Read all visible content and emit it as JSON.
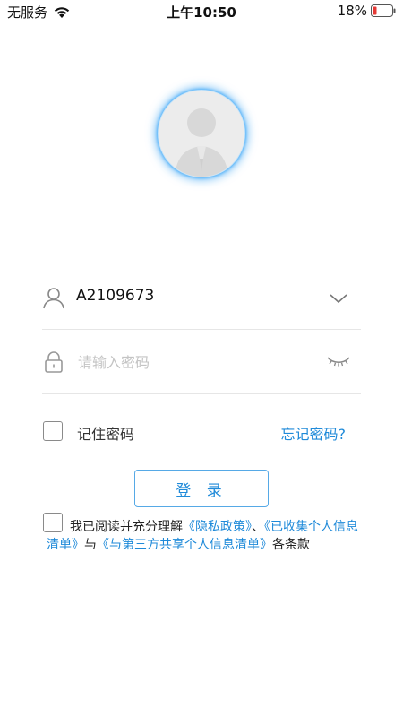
{
  "status_bar": {
    "carrier": "无服务",
    "time": "上午10:50",
    "battery": "18%"
  },
  "login": {
    "account_value": "A2109673",
    "password_placeholder": "请输入密码",
    "remember_label": "记住密码",
    "forgot_label": "忘记密码?",
    "login_button": "登 录"
  },
  "agreement": {
    "prefix": "我已阅读并充分理解",
    "link_privacy": "《隐私政策》",
    "sep1": "、",
    "link_collected": "《已收集个人信息清单》",
    "sep2": "与",
    "link_third_party": "《与第三方共享个人信息清单》",
    "suffix": "各条款"
  },
  "colors": {
    "accent": "#1f8ad9",
    "battery_low": "#e53935",
    "avatar_glow": "#1e96f0"
  },
  "icons": {
    "wifi": "wifi-icon",
    "battery": "battery-icon",
    "avatar": "avatar-placeholder-icon",
    "user": "user-icon",
    "lock": "lock-icon",
    "chevron": "chevron-down-icon",
    "eye": "eye-closed-icon"
  }
}
